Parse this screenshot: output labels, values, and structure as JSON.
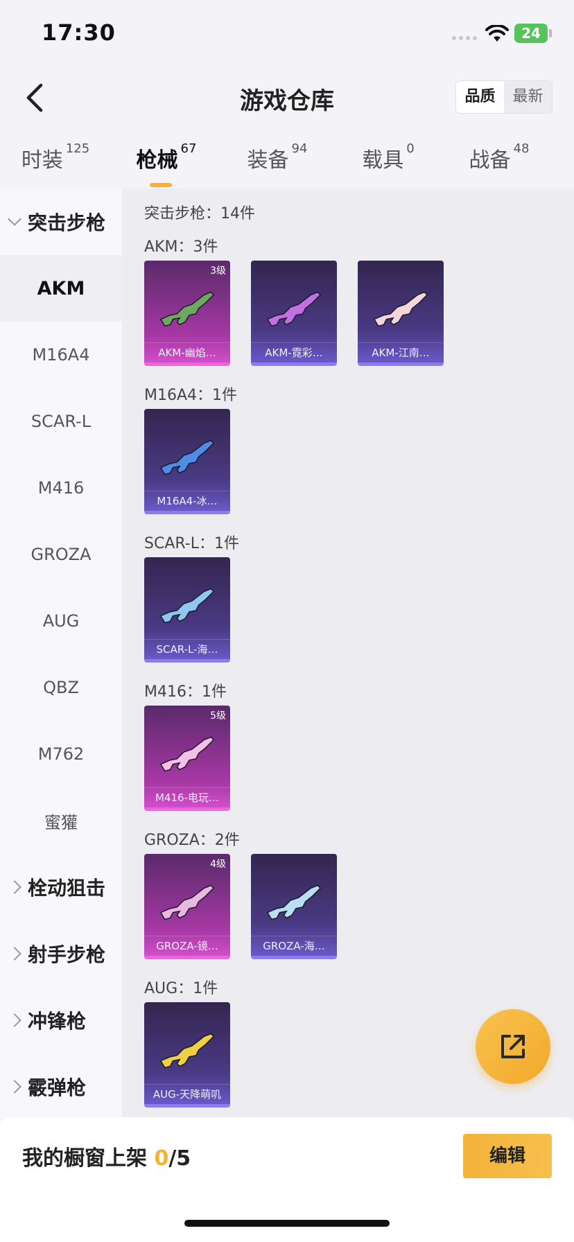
{
  "status_bar": {
    "time": "17:30",
    "battery": "24"
  },
  "header": {
    "title": "游戏仓库",
    "sort_options": [
      "品质",
      "最新"
    ],
    "active_sort": "品质"
  },
  "tabs": [
    {
      "label": "时装",
      "count": "125"
    },
    {
      "label": "枪械",
      "count": "67"
    },
    {
      "label": "装备",
      "count": "94"
    },
    {
      "label": "载具",
      "count": "0"
    },
    {
      "label": "战备",
      "count": "48"
    }
  ],
  "sidebar": {
    "expanded_group": "突击步枪",
    "items": [
      "AKM",
      "M16A4",
      "SCAR-L",
      "M416",
      "GROZA",
      "AUG",
      "QBZ",
      "M762",
      "蜜獾"
    ],
    "active_item": "AKM",
    "collapsed_groups": [
      "栓动狙击",
      "射手步枪",
      "冲锋枪",
      "霰弹枪"
    ]
  },
  "content": {
    "section_total": "突击步枪：14件",
    "groups": [
      {
        "title": "AKM：3件",
        "items": [
          {
            "name": "AKM-幽焰…",
            "grade": "3级",
            "rarity": "pink",
            "color": "#6fa860"
          },
          {
            "name": "AKM-霓彩…",
            "grade": "",
            "rarity": "purple",
            "color": "#c070e0"
          },
          {
            "name": "AKM-江南…",
            "grade": "",
            "rarity": "purple",
            "color": "#f2d6dc"
          }
        ]
      },
      {
        "title": "M16A4：1件",
        "items": [
          {
            "name": "M16A4-冰…",
            "grade": "",
            "rarity": "purple",
            "color": "#4e8ce8"
          }
        ]
      },
      {
        "title": "SCAR-L：1件",
        "items": [
          {
            "name": "SCAR-L-海…",
            "grade": "",
            "rarity": "purple",
            "color": "#8ec8f0"
          }
        ]
      },
      {
        "title": "M416：1件",
        "items": [
          {
            "name": "M416-电玩…",
            "grade": "5级",
            "rarity": "pink",
            "color": "#f4c0e8"
          }
        ]
      },
      {
        "title": "GROZA：2件",
        "items": [
          {
            "name": "GROZA-镜…",
            "grade": "4级",
            "rarity": "pink",
            "color": "#e8b8e0"
          },
          {
            "name": "GROZA-海…",
            "grade": "",
            "rarity": "purple",
            "color": "#b8e0f0"
          }
        ]
      },
      {
        "title": "AUG：1件",
        "items": [
          {
            "name": "AUG-天降萌叽",
            "grade": "",
            "rarity": "purple",
            "color": "#f0d040"
          }
        ]
      }
    ]
  },
  "bottom_bar": {
    "shelf_label": "我的橱窗上架",
    "shelf_count": "0",
    "shelf_total": "/5",
    "edit_label": "编辑"
  }
}
